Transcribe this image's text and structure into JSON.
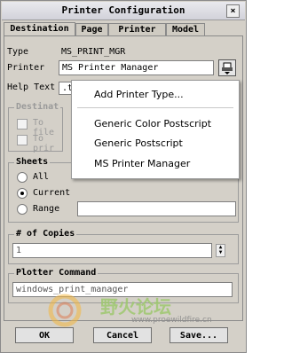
{
  "window": {
    "title": "Printer Configuration",
    "close_glyph": "×"
  },
  "tabs": [
    "Destination",
    "Page",
    "Printer",
    "Model"
  ],
  "destination": {
    "type_label": "Type",
    "type_value": "MS_PRINT_MGR",
    "printer_label": "Printer",
    "printer_value": "MS Printer Manager",
    "help_text_label": "Help Text",
    "help_text_value": ".t"
  },
  "printer_dropdown": {
    "items": [
      "Add Printer Type...",
      "Generic Color Postscript",
      "Generic Postscript",
      "MS Printer Manager"
    ]
  },
  "destination_group": {
    "title": "Destinat",
    "to_file_label": "To file",
    "to_printer_label": "To prir"
  },
  "sheets": {
    "title": "Sheets",
    "options": [
      "All",
      "Current",
      "Range"
    ],
    "selected": "Current"
  },
  "copies": {
    "title": "# of Copies",
    "value": "1"
  },
  "plotter": {
    "title": "Plotter Command",
    "value": "windows_print_manager"
  },
  "buttons": {
    "ok": "OK",
    "cancel": "Cancel",
    "save": "Save..."
  },
  "watermark": {
    "text": "野火论坛",
    "url": "www.proewildfire.cn"
  }
}
